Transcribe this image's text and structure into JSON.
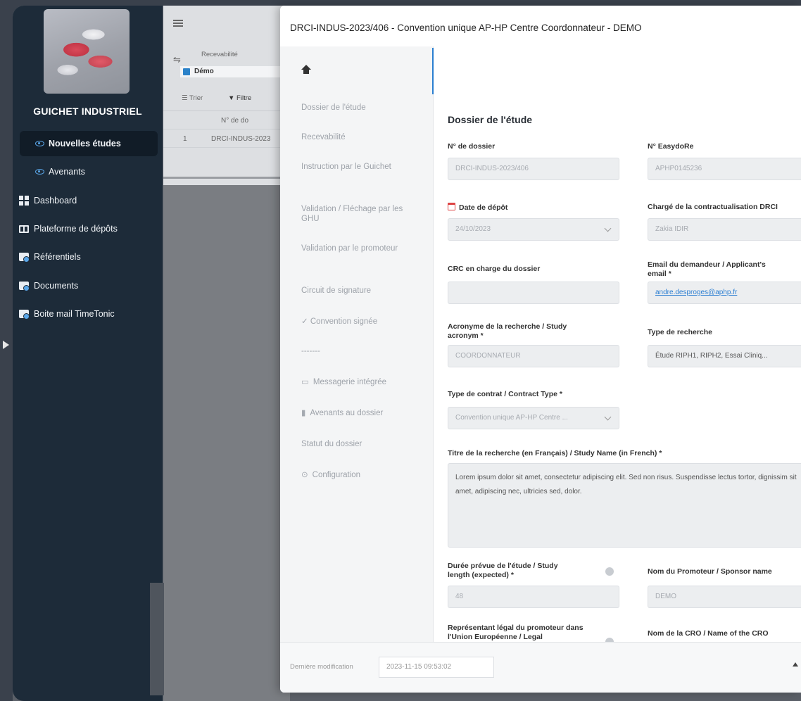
{
  "sidebar": {
    "brand": "GUICHET INDUSTRIEL",
    "items": [
      {
        "label": "Nouvelles études",
        "icon": "eye-icon",
        "active": true
      },
      {
        "label": "Avenants",
        "icon": "eye-icon"
      },
      {
        "label": "Dashboard",
        "icon": "grid-icon"
      },
      {
        "label": "Plateforme de dépôts",
        "icon": "book-icon"
      },
      {
        "label": "Référentiels",
        "icon": "folder-icon"
      },
      {
        "label": "Documents",
        "icon": "folder-icon"
      },
      {
        "label": "Boite mail TimeTonic",
        "icon": "folder-icon"
      }
    ]
  },
  "list_view": {
    "filter_label": "Recevabilité",
    "demo_tag": "Démo",
    "sort_label": "Trier",
    "filter_button": "Filtre",
    "column_header": "N° de do",
    "row_index": "1",
    "row_value": "DRCI-INDUS-2023"
  },
  "modal": {
    "title": "DRCI-INDUS-2023/406 - Convention unique AP-HP Centre Coordonnateur - DEMO",
    "menu": [
      "Dossier de l'étude",
      "Recevabilité",
      "Instruction par le Guichet",
      "Validation / Fléchage par les GHU",
      "Validation par le promoteur",
      "Circuit de signature",
      "✓ Convention signée",
      "-------",
      "Messagerie intégrée",
      "Avenants au dossier",
      "Statut du dossier",
      "Configuration"
    ],
    "section_title": "Dossier de l'étude",
    "fields": {
      "dossier_label": "N° de dossier",
      "dossier_value": "DRCI-INDUS-2023/406",
      "easydore_label": "N° EasydoRe",
      "easydore_value": "APHP0145236",
      "date_label": "Date de dépôt",
      "date_value": "24/10/2023",
      "charge_label": "Chargé de la contractualisation DRCI",
      "charge_value": "Zakia IDIR",
      "crc_label": "CRC en charge du dossier",
      "crc_value": "",
      "email_label": "Email du demandeur / Applicant's email *",
      "email_value": "andre.desproges@aphp.fr",
      "acronym_label": "Acronyme de la recherche / Study acronym *",
      "acronym_value": "COORDONNATEUR",
      "type_recherche_label": "Type de recherche",
      "type_recherche_value": "Étude RIPH1, RIPH2, Essai Cliniq...",
      "contract_label": "Type de contrat / Contract Type *",
      "contract_value": "Convention unique AP-HP Centre ...",
      "titre_label": "Titre de la recherche (en Français) / Study Name (in French) *",
      "titre_value": "Lorem ipsum dolor sit amet, consectetur adipiscing elit. Sed non risus. Suspendisse lectus tortor, dignissim sit amet, adipiscing nec, ultricies sed, dolor.",
      "duree_label": "Durée prévue de l'étude / Study length (expected) *",
      "duree_value": "48",
      "promoteur_label": "Nom du Promoteur / Sponsor name",
      "promoteur_value": "DEMO",
      "representant_label": "Représentant légal du promoteur dans l'Union Européenne / Legal",
      "cro_label": "Nom de la CRO / Name of the CRO"
    },
    "footer": {
      "label": "Dernière modification",
      "value": "2023-11-15 09:53:02"
    }
  }
}
